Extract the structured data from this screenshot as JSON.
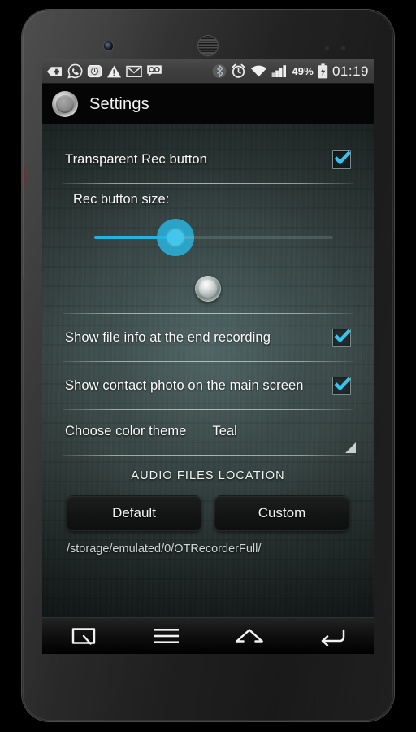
{
  "device": {
    "name": "android-phone",
    "hardware": {
      "earpiece": "speaker-grille",
      "front_camera": "front-camera",
      "sensors": [
        "proximity-sensor",
        "light-sensor"
      ]
    }
  },
  "status_bar": {
    "left_icons": [
      {
        "name": "tag-plus-icon",
        "label": "tag"
      },
      {
        "name": "whatsapp-icon",
        "label": "WhatsApp"
      },
      {
        "name": "camera-clock-icon",
        "label": "camera"
      },
      {
        "name": "warning-triangle-icon",
        "label": "warning"
      },
      {
        "name": "gmail-icon",
        "label": "M"
      },
      {
        "name": "voicemail-icon",
        "label": "voicemail"
      }
    ],
    "right_icons": [
      {
        "name": "bluetooth-icon",
        "label": "Bluetooth"
      },
      {
        "name": "alarm-clock-icon",
        "label": "Alarm"
      },
      {
        "name": "wifi-icon",
        "label": "Wi-Fi"
      },
      {
        "name": "cellular-signal-icon",
        "label": "Signal"
      }
    ],
    "battery_percent": "49%",
    "battery_state": "charging",
    "clock": "01:19"
  },
  "action_bar": {
    "icon": "record-button-icon",
    "title": "Settings"
  },
  "settings": {
    "transparent_rec": {
      "label": "Transparent Rec button",
      "checked": true
    },
    "rec_button_size": {
      "label": "Rec button size:",
      "value_percent": 35,
      "preview": "record-button-preview"
    },
    "show_file_info": {
      "label": "Show file info at the end recording",
      "checked": true
    },
    "show_contact_photo": {
      "label": "Show contact photo on the main screen",
      "checked": true
    },
    "color_theme": {
      "label": "Choose color theme",
      "value": "Teal",
      "options": [
        "Teal"
      ]
    }
  },
  "audio_location": {
    "header": "AUDIO FILES LOCATION",
    "default_button": "Default",
    "custom_button": "Custom",
    "path": "/storage/emulated/0/OTRecorderFull/"
  },
  "nav_bar": {
    "buttons": [
      {
        "name": "recents-search-button",
        "label": "Recents"
      },
      {
        "name": "menu-button",
        "label": "Menu"
      },
      {
        "name": "home-button",
        "label": "Home"
      },
      {
        "name": "back-button",
        "label": "Back"
      }
    ]
  },
  "colors": {
    "accent": "#29b4de",
    "accent_light": "#43c5ec",
    "status_bar_bg": "#3f3f3f",
    "action_bar_bg": "#050505",
    "text_primary": "#fbfbfb",
    "wallpaper_base": "#3b4a49"
  }
}
